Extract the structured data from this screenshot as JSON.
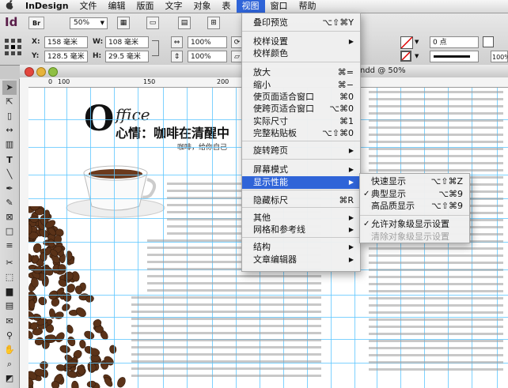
{
  "menubar": {
    "apple": "",
    "app": "InDesign",
    "items": [
      "文件",
      "编辑",
      "版面",
      "文字",
      "对象",
      "表",
      "视图",
      "窗口",
      "帮助"
    ],
    "active_index": 6
  },
  "control": {
    "logo": "Id",
    "bridge": "Br",
    "zoom": "50%",
    "x_label": "X:",
    "x_value": "158 毫米",
    "y_label": "Y:",
    "y_value": "128.5 毫米",
    "w_label": "W:",
    "w_value": "108 毫米",
    "h_label": "H:",
    "h_value": "29.5 毫米",
    "scale_x": "100%",
    "scale_y": "100%",
    "stroke_weight": "0 点",
    "right_pct": "100%"
  },
  "document": {
    "title_fragment": "ndd @ 50%",
    "ruler_marks": [
      "0",
      "100",
      "150",
      "200"
    ],
    "office_heading": "ffice",
    "office_big": "O",
    "office_sub": "心情：咖啡在清醒中",
    "tagline": "咖啡，给你自己"
  },
  "view_menu": {
    "items": [
      {
        "label": "叠印预览",
        "shortcut": "⌥⇧⌘Y"
      },
      {
        "label": "校样设置",
        "submenu": true
      },
      {
        "label": "校样颜色"
      },
      {
        "label": "放大",
        "shortcut": "⌘="
      },
      {
        "label": "缩小",
        "shortcut": "⌘−"
      },
      {
        "label": "使页面适合窗口",
        "shortcut": "⌘0"
      },
      {
        "label": "使跨页适合窗口",
        "shortcut": "⌥⌘0"
      },
      {
        "label": "实际尺寸",
        "shortcut": "⌘1"
      },
      {
        "label": "完整粘贴板",
        "shortcut": "⌥⇧⌘0"
      },
      {
        "label": "旋转跨页",
        "submenu": true
      },
      {
        "label": "屏幕模式",
        "submenu": true
      },
      {
        "label": "显示性能",
        "submenu": true,
        "highlight": true
      },
      {
        "label": "隐藏标尺",
        "shortcut": "⌘R"
      },
      {
        "label": "其他",
        "submenu": true
      },
      {
        "label": "网格和参考线",
        "submenu": true
      },
      {
        "label": "结构",
        "submenu": true
      },
      {
        "label": "文章编辑器",
        "submenu": true
      }
    ]
  },
  "perf_menu": {
    "items": [
      {
        "label": "快速显示",
        "shortcut": "⌥⇧⌘Z"
      },
      {
        "label": "典型显示",
        "shortcut": "⌥⌘9",
        "checked": true
      },
      {
        "label": "高品质显示",
        "shortcut": "⌥⇧⌘9"
      },
      {
        "label": "允许对象级显示设置",
        "checked": true
      },
      {
        "label": "清除对象级显示设置",
        "disabled": true
      }
    ],
    "check_mark": "✓"
  },
  "colors": {
    "accent": "#2f64d8",
    "guide": "#5ec7ff",
    "coffee": "#5a3218"
  }
}
